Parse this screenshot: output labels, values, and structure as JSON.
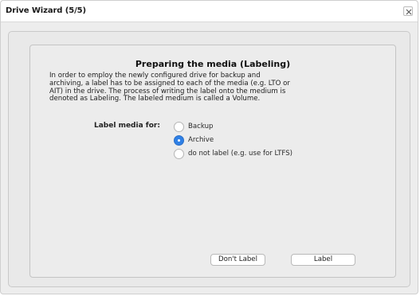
{
  "window": {
    "title": "Drive Wizard (5/5)"
  },
  "content": {
    "heading": "Preparing the media (Labeling)",
    "description": "In order to employ the newly configured drive for backup and\narchiving, a label has to be assigned to each of the media (e.g. LTO or\nAIT) in the drive. The process of writing the label onto the medium is\ndenoted as Labeling. The labeled medium is called a Volume.",
    "label_media_for": "Label media for:",
    "options": [
      {
        "label": "Backup",
        "selected": false
      },
      {
        "label": "Archive",
        "selected": true
      },
      {
        "label": "do not label (e.g. use for LTFS)",
        "selected": false
      }
    ]
  },
  "buttons": {
    "dont_label": "Don't Label",
    "label": "Label"
  },
  "colors": {
    "accent": "#2f80e6",
    "window_bg": "#ededed"
  },
  "icons": {
    "close": "close-icon"
  }
}
